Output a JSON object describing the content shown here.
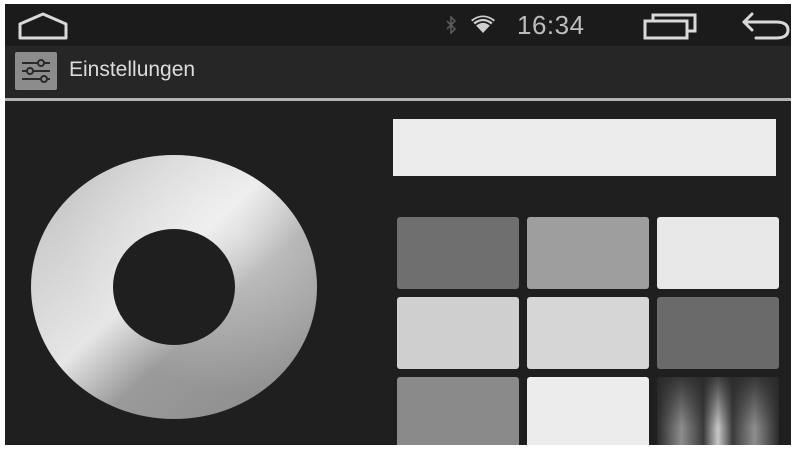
{
  "status_bar": {
    "time": "16:34",
    "icons": [
      "home-icon",
      "bluetooth-icon",
      "wifi-icon",
      "recent-apps-icon",
      "back-icon"
    ]
  },
  "action_bar": {
    "title": "Einstellungen",
    "icon": "settings-sliders-icon"
  },
  "color_picker": {
    "preview_color": "#ececec",
    "wheel": "color-wheel",
    "swatches": [
      {
        "color": "#6f6f6f"
      },
      {
        "color": "#9e9e9e"
      },
      {
        "color": "#e8e8e8"
      },
      {
        "color": "#cfcfcf"
      },
      {
        "color": "#d6d6d6"
      },
      {
        "color": "#6a6a6a"
      },
      {
        "color": "#8a8a8a"
      },
      {
        "color": "#ececec"
      },
      {
        "color": "gradient"
      }
    ]
  }
}
